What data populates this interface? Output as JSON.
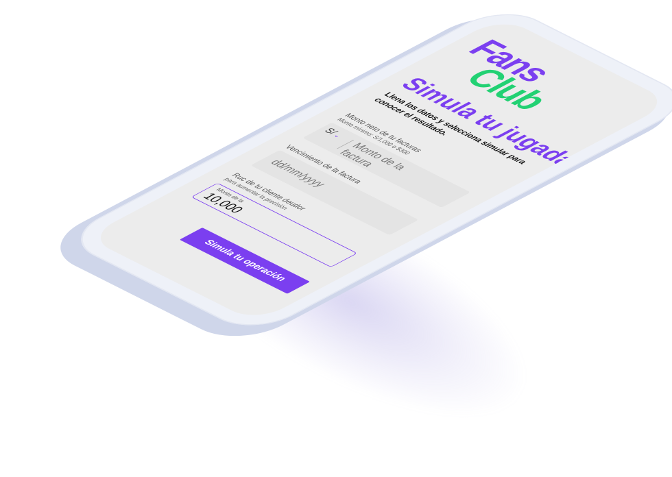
{
  "brand": {
    "line1": "Fans",
    "line2": "Club"
  },
  "title": "Simula tu jugada",
  "subtitle": "Llena los datos y selecciona simular para conocer el resultado.",
  "amount": {
    "label": "Monto neto de tu facturas",
    "hint": "Monto mínimo: S/1,000 o $300",
    "currency": "S/",
    "placeholder": "Monto de la factura"
  },
  "due_date": {
    "label": "Vencimiento de la factura",
    "placeholder": "dd/mm/yyyy"
  },
  "ruc": {
    "label": "Ruc de tu cliente deudor",
    "hint": "para aumentar la precisión",
    "field_label": "Monto de la",
    "value": "10,000"
  },
  "cta_label": "Simula tu operación",
  "colors": {
    "brand_purple": "#7b3ff0",
    "brand_green": "#22d173",
    "screen_bg": "#ececec"
  }
}
